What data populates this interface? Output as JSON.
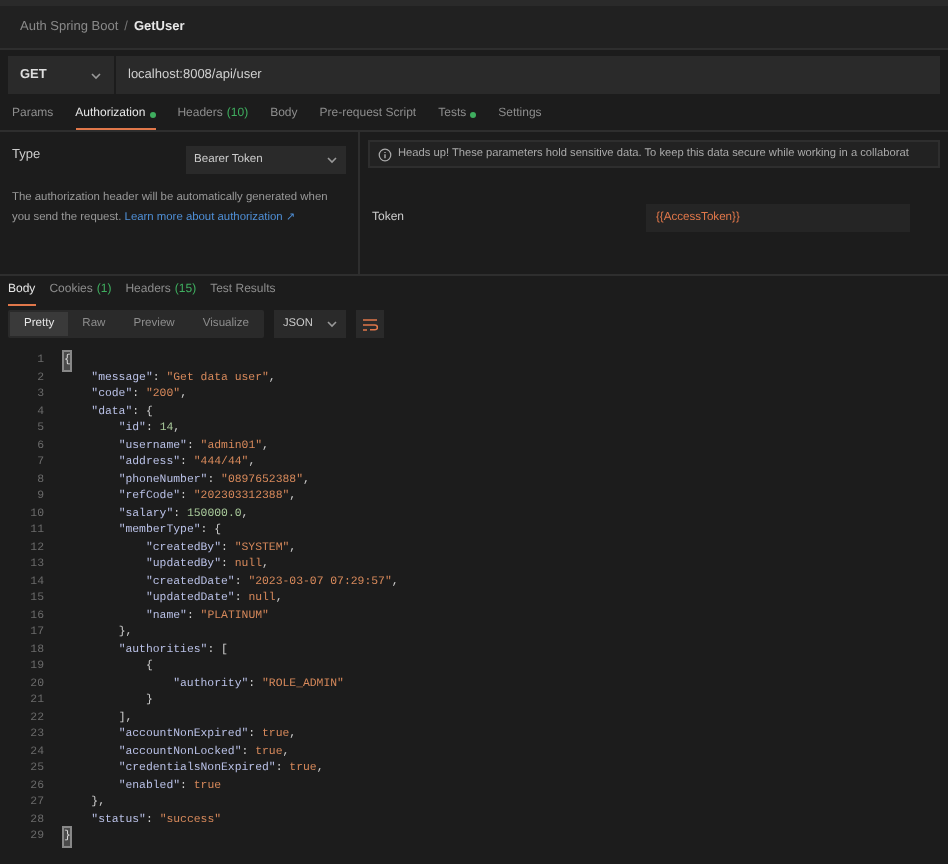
{
  "breadcrumb": {
    "collection": "Auth Spring Boot",
    "separator": "/",
    "request": "GetUser"
  },
  "request": {
    "method": "GET",
    "url": "localhost:8008/api/user"
  },
  "request_tabs": [
    {
      "label": "Params",
      "selected": false,
      "indicator": false
    },
    {
      "label": "Authorization",
      "selected": true,
      "indicator": true
    },
    {
      "label": "Headers",
      "count": "(10)",
      "selected": false,
      "indicator": false
    },
    {
      "label": "Body",
      "selected": false,
      "indicator": false
    },
    {
      "label": "Pre-request Script",
      "selected": false,
      "indicator": false
    },
    {
      "label": "Tests",
      "selected": false,
      "indicator": true
    },
    {
      "label": "Settings",
      "selected": false,
      "indicator": false
    }
  ],
  "auth": {
    "type_label": "Type",
    "type_value": "Bearer Token",
    "description": "The authorization header will be automatically generated when you send the request.",
    "link": "Learn more about authorization ↗",
    "notice": "Heads up! These parameters hold sensitive data. To keep this data secure while working in a collaborat",
    "token_label": "Token",
    "token_value": "{{AccessToken}}"
  },
  "response_tabs": [
    {
      "label": "Body",
      "selected": true
    },
    {
      "label": "Cookies",
      "count": "(1)",
      "selected": false
    },
    {
      "label": "Headers",
      "count": "(15)",
      "selected": false
    },
    {
      "label": "Test Results",
      "selected": false
    }
  ],
  "view_modes": [
    {
      "label": "Pretty",
      "selected": true
    },
    {
      "label": "Raw",
      "selected": false
    },
    {
      "label": "Preview",
      "selected": false
    },
    {
      "label": "Visualize",
      "selected": false
    }
  ],
  "format": "JSON",
  "code_lines": [
    {
      "number": "1",
      "text": "{",
      "highlighted": true
    },
    {
      "number": "2",
      "text": "    \"message\": \"Get data user\",",
      "highlighted": false
    },
    {
      "number": "3",
      "text": "    \"code\": \"200\",",
      "highlighted": false
    },
    {
      "number": "4",
      "text": "    \"data\": {",
      "highlighted": false
    },
    {
      "number": "5",
      "text": "        \"id\": 14,",
      "highlighted": false
    },
    {
      "number": "6",
      "text": "        \"username\": \"admin01\",",
      "highlighted": false
    },
    {
      "number": "7",
      "text": "        \"address\": \"444/44\",",
      "highlighted": false
    },
    {
      "number": "8",
      "text": "        \"phoneNumber\": \"0897652388\",",
      "highlighted": false
    },
    {
      "number": "9",
      "text": "        \"refCode\": \"202303312388\",",
      "highlighted": false
    },
    {
      "number": "10",
      "text": "        \"salary\": 150000.0,",
      "highlighted": false
    },
    {
      "number": "11",
      "text": "        \"memberType\": {",
      "highlighted": false
    },
    {
      "number": "12",
      "text": "            \"createdBy\": \"SYSTEM\",",
      "highlighted": false
    },
    {
      "number": "13",
      "text": "            \"updatedBy\": null,",
      "highlighted": false
    },
    {
      "number": "14",
      "text": "            \"createdDate\": \"2023-03-07 07:29:57\",",
      "highlighted": false
    },
    {
      "number": "15",
      "text": "            \"updatedDate\": null,",
      "highlighted": false
    },
    {
      "number": "16",
      "text": "            \"name\": \"PLATINUM\"",
      "highlighted": false
    },
    {
      "number": "17",
      "text": "        },",
      "highlighted": false
    },
    {
      "number": "18",
      "text": "        \"authorities\": [",
      "highlighted": false
    },
    {
      "number": "19",
      "text": "            {",
      "highlighted": false
    },
    {
      "number": "20",
      "text": "                \"authority\": \"ROLE_ADMIN\"",
      "highlighted": false
    },
    {
      "number": "21",
      "text": "            }",
      "highlighted": false
    },
    {
      "number": "22",
      "text": "        ],",
      "highlighted": false
    },
    {
      "number": "23",
      "text": "        \"accountNonExpired\": true,",
      "highlighted": false
    },
    {
      "number": "24",
      "text": "        \"accountNonLocked\": true,",
      "highlighted": false
    },
    {
      "number": "25",
      "text": "        \"credentialsNonExpired\": true,",
      "highlighted": false
    },
    {
      "number": "26",
      "text": "        \"enabled\": true",
      "highlighted": false
    },
    {
      "number": "27",
      "text": "    },",
      "highlighted": false
    },
    {
      "number": "28",
      "text": "    \"status\": \"success\"",
      "highlighted": false
    },
    {
      "number": "29",
      "text": "}",
      "highlighted": true
    }
  ]
}
